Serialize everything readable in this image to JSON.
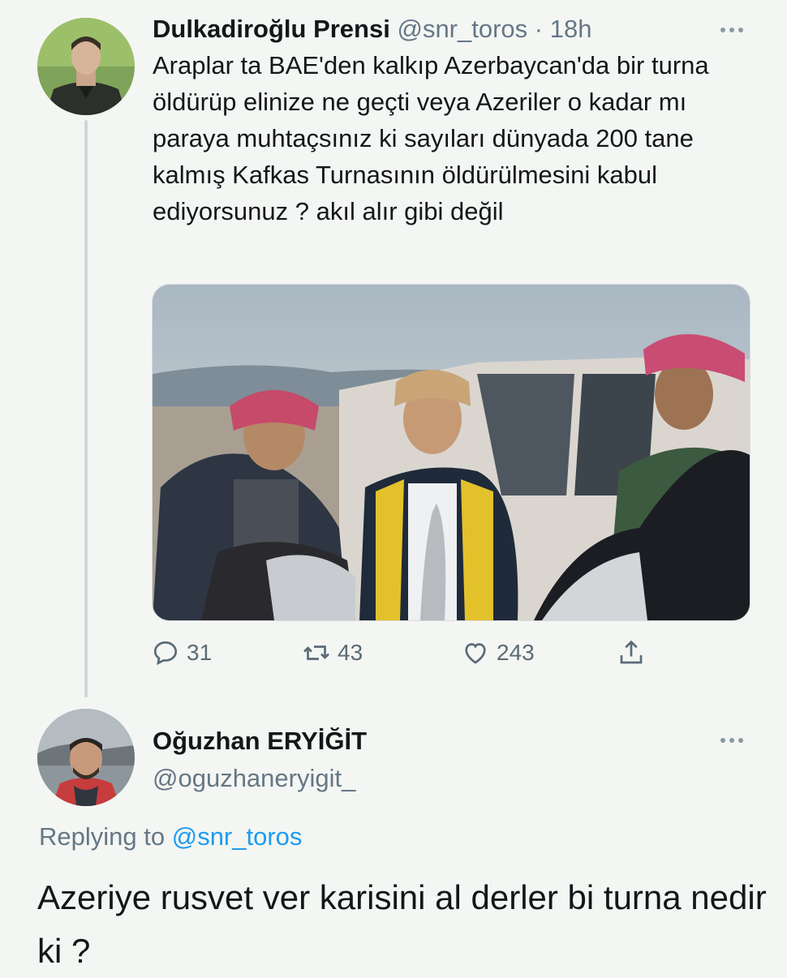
{
  "tweet": {
    "author_name": "Dulkadiroğlu Prensi",
    "handle": "@snr_toros",
    "separator": "·",
    "time": "18h",
    "text": "Araplar ta BAE'den kalkıp Azerbaycan'da bir turna öldürüp elinize ne geçti veya Azeriler o kadar mı paraya muhtaçsınız ki sayıları dünyada 200 tane kalmış Kafkas Turnasının öldürülmesini kabul ediyorsunuz ? akıl alır gibi değil",
    "actions": {
      "replies": "31",
      "retweets": "43",
      "likes": "243"
    },
    "icons": [
      "more-icon",
      "reply-icon",
      "retweet-icon",
      "like-icon",
      "share-icon"
    ]
  },
  "reply": {
    "author_name": "Oğuzhan ERYİĞİT",
    "handle": "@oguzhaneryigit_",
    "replying_prefix": "Replying to",
    "replying_to": "@snr_toros",
    "text": "Azeriye rusvet ver karisini al derler bi turna nedir ki ?"
  },
  "colors": {
    "background": "#f4f6f3",
    "text": "#14171a",
    "muted": "#657786",
    "link": "#1d9bf0",
    "thread_line": "#cfd6da"
  }
}
